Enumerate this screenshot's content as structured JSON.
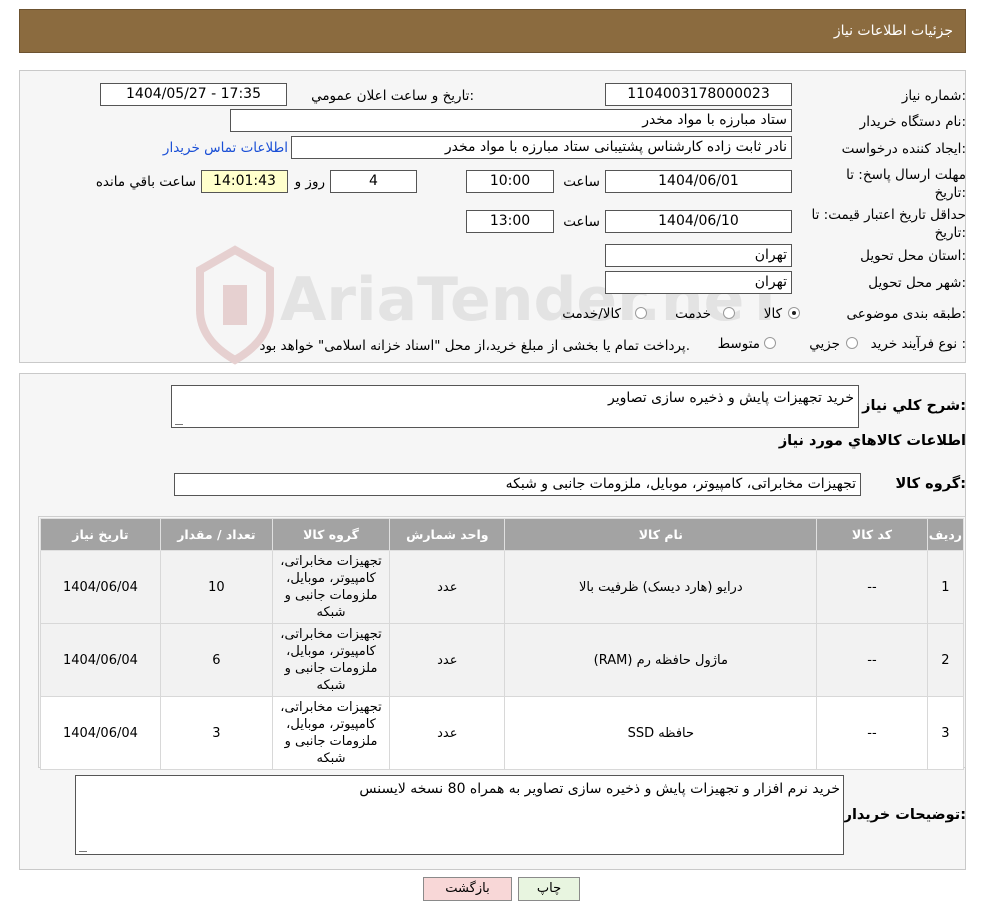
{
  "header": {
    "title": "جزئیات اطلاعات نیاز"
  },
  "watermark": {
    "text": "AriaTender.neT"
  },
  "form": {
    "need_number": {
      "label": "شماره نیاز:",
      "value": "1104003178000023"
    },
    "announce_datetime": {
      "label": "تاریخ و ساعت اعلان عمومي:",
      "value": "1404/05/27 - 17:35"
    },
    "buyer_org": {
      "label": "نام دستگاه خریدار:",
      "value": "ستاد مبارزه با مواد مخدر"
    },
    "creator": {
      "label": "ایجاد کننده درخواست:",
      "value": "نادر ثابت زاده کارشناس پشتیبانی ستاد مبارزه با مواد مخدر",
      "contact_link": "اطلاعات تماس خریدار"
    },
    "deadline": {
      "label": "مهلت ارسال پاسخ: تا تاریخ:",
      "date": "1404/06/01",
      "time_label": "ساعت",
      "time": "10:00",
      "days": "4",
      "days_label": "روز و",
      "remaining": "14:01:43",
      "remaining_label": "ساعت باقي مانده"
    },
    "price_validity": {
      "label": "حداقل تاریخ اعتبار قیمت: تا تاریخ:",
      "date": "1404/06/10",
      "time_label": "ساعت",
      "time": "13:00"
    },
    "province": {
      "label": "استان محل تحویل:",
      "value": "تهران"
    },
    "city": {
      "label": "شهر محل تحویل:",
      "value": "تهران"
    },
    "category": {
      "label": "طبقه بندی موضوعی:",
      "options": [
        "کالا",
        "خدمت",
        "کالا/خدمت"
      ],
      "selected": "کالا"
    },
    "process": {
      "label": "نوع فرآیند خرید :",
      "options": [
        "جزيي",
        "متوسط"
      ],
      "note": "پرداخت تمام یا بخشی از مبلغ خرید،از محل \"اسناد خزانه اسلامی\" خواهد بود."
    }
  },
  "summary": {
    "general_label": "شرح كلي نیاز:",
    "general_value": "خرید تجهیزات پایش و ذخیره سازی تصاویر",
    "goods_info_title": "اطلاعات کالاهاي مورد نیاز",
    "goods_group_label": "گروه کالا:",
    "goods_group_value": "تجهیزات مخابراتی، کامپیوتر، موبایل، ملزومات جانبی و شبکه"
  },
  "table": {
    "headers": [
      "ردیف",
      "کد کالا",
      "نام کالا",
      "واحد شمارش",
      "گروه کالا",
      "تعداد / مقدار",
      "تاریخ نیاز"
    ],
    "rows": [
      {
        "row": "1",
        "code": "--",
        "name": "درایو (هارد دیسک) ظرفیت بالا",
        "unit": "عدد",
        "group": "تجهیزات مخابراتی، کامپیوتر، موبایل، ملزومات جانبی و شبکه",
        "qty": "10",
        "date": "1404/06/04"
      },
      {
        "row": "2",
        "code": "--",
        "name": "ماژول حافظه رم (RAM)",
        "unit": "عدد",
        "group": "تجهیزات مخابراتی، کامپیوتر، موبایل، ملزومات جانبی و شبکه",
        "qty": "6",
        "date": "1404/06/04"
      },
      {
        "row": "3",
        "code": "--",
        "name": "حافظه SSD",
        "unit": "عدد",
        "group": "تجهیزات مخابراتی، کامپیوتر، موبایل، ملزومات جانبی و شبکه",
        "qty": "3",
        "date": "1404/06/04"
      }
    ]
  },
  "buyer_notes": {
    "label": "توضیحات خریدار:",
    "value": "خرید نرم افزار و تجهیزات پایش و ذخیره سازی تصاویر به همراه 80 نسخه لایسنس"
  },
  "buttons": {
    "print": "چاپ",
    "back": "بازگشت"
  },
  "colors": {
    "header_bg": "#8b6b3f",
    "back_button_bg": "#f8d7d7",
    "print_button_bg": "#e8f5e0",
    "remaining_bg": "#ffffcc",
    "link": "#1a4fd6"
  }
}
